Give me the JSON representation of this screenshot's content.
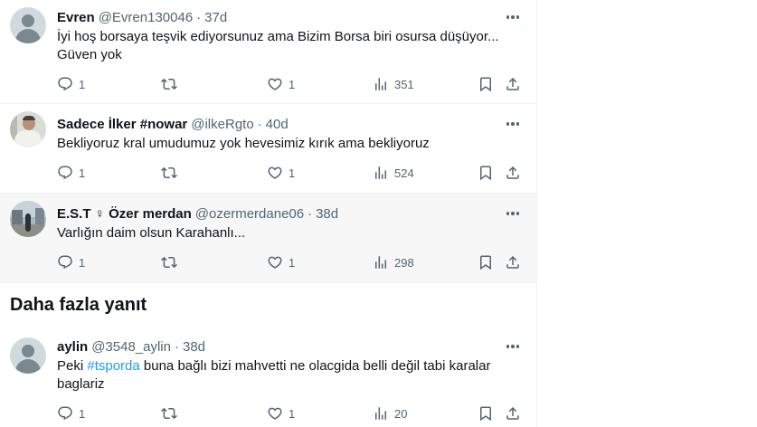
{
  "tweets": [
    {
      "name": "Evren",
      "handle": "@Evren130046",
      "sep": "·",
      "time": "37d",
      "text": "İyi hoş borsaya teşvik ediyorsunuz ama Bizim Borsa biri osursa düşüyor... Güven yok",
      "replies": "1",
      "likes": "1",
      "views": "351"
    },
    {
      "name": "Sadece İlker #nowar",
      "handle": "@ilkeRgto",
      "sep": "·",
      "time": "40d",
      "text": "Bekliyoruz kral umudumuz yok hevesimiz kırık ama bekliyoruz",
      "replies": "1",
      "likes": "1",
      "views": "524"
    },
    {
      "name": "E.S.T ♀ Özer merdan",
      "handle": "@ozermerdane06",
      "sep": "·",
      "time": "38d",
      "text": "Varlığın daim olsun Karahanlı...",
      "replies": "1",
      "likes": "1",
      "views": "298"
    },
    {
      "name": "aylin",
      "handle": "@3548_aylin",
      "sep": "·",
      "time": "38d",
      "text_before": "Peki ",
      "hashtag": "#tsporda",
      "text_after": " buna bağlı bizi mahvetti ne olacgida belli değil tabi karalar baglariz",
      "replies": "1",
      "likes": "1",
      "views": "20"
    }
  ],
  "more_replies_heading": "Daha fazla yanıt",
  "colors": {
    "text": "#0f1419",
    "secondary": "#536471",
    "link": "#1d9bf0",
    "border": "#eff3f4",
    "hover_bg": "#f7f7f7"
  },
  "icons": {
    "reply": "reply-icon",
    "retweet": "retweet-icon",
    "like": "like-icon",
    "views": "views-icon",
    "bookmark": "bookmark-icon",
    "share": "share-icon",
    "more": "more-icon"
  }
}
